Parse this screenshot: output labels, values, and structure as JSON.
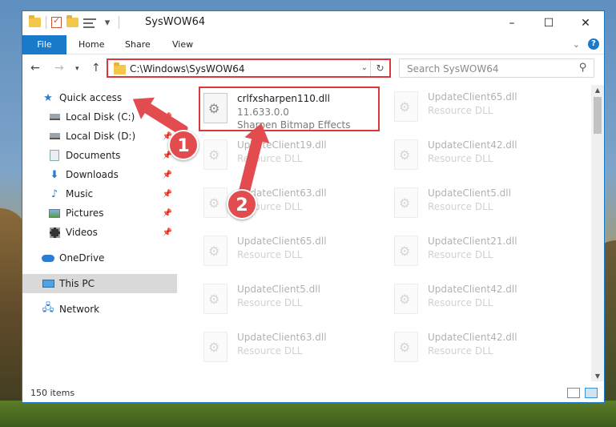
{
  "window": {
    "title": "SysWOW64",
    "controls": {
      "minimize": "–",
      "maximize": "☐",
      "close": "✕"
    }
  },
  "ribbon": {
    "tabs": [
      "File",
      "Home",
      "Share",
      "View"
    ],
    "help": "?"
  },
  "navigation": {
    "address": "C:\\Windows\\SysWOW64",
    "search_placeholder": "Search SysWOW64"
  },
  "nav_pane": {
    "items": [
      {
        "label": "Quick access",
        "icon": "star-icon",
        "pinned": false
      },
      {
        "label": "Local Disk (C:)",
        "icon": "drive-icon",
        "pinned": true
      },
      {
        "label": "Local Disk (D:)",
        "icon": "drive-icon",
        "pinned": true
      },
      {
        "label": "Documents",
        "icon": "documents-icon",
        "pinned": true
      },
      {
        "label": "Downloads",
        "icon": "download-icon",
        "pinned": true
      },
      {
        "label": "Music",
        "icon": "music-icon",
        "pinned": true
      },
      {
        "label": "Pictures",
        "icon": "pictures-icon",
        "pinned": true
      },
      {
        "label": "Videos",
        "icon": "videos-icon",
        "pinned": true
      },
      {
        "label": "OneDrive",
        "icon": "cloud-icon",
        "pinned": false
      },
      {
        "label": "This PC",
        "icon": "computer-icon",
        "pinned": false,
        "selected": true
      },
      {
        "label": "Network",
        "icon": "network-icon",
        "pinned": false
      }
    ]
  },
  "files": {
    "highlighted": {
      "name": "crlfxsharpen110.dll",
      "version": "11.633.0.0",
      "description": "Sharpen Bitmap Effects"
    },
    "left_column": [
      {
        "name": "UpdateClient19.dll",
        "type": "Resource DLL"
      },
      {
        "name": "UpdateClient63.dll",
        "type": "Resource DLL"
      },
      {
        "name": "UpdateClient65.dll",
        "type": "Resource DLL"
      },
      {
        "name": "UpdateClient5.dll",
        "type": "Resource DLL"
      },
      {
        "name": "UpdateClient63.dll",
        "type": "Resource DLL"
      }
    ],
    "right_column": [
      {
        "name": "UpdateClient65.dll",
        "type": "Resource DLL"
      },
      {
        "name": "UpdateClient42.dll",
        "type": "Resource DLL"
      },
      {
        "name": "UpdateClient5.dll",
        "type": "Resource DLL"
      },
      {
        "name": "UpdateClient21.dll",
        "type": "Resource DLL"
      },
      {
        "name": "UpdateClient42.dll",
        "type": "Resource DLL"
      },
      {
        "name": "UpdateClient42.dll",
        "type": "Resource DLL"
      }
    ]
  },
  "status": {
    "item_count": "150 items"
  },
  "annotations": {
    "step1": "1",
    "step2": "2"
  },
  "colors": {
    "accent": "#1979ca",
    "highlight": "#d9393a",
    "annotation": "#e34c4f"
  }
}
